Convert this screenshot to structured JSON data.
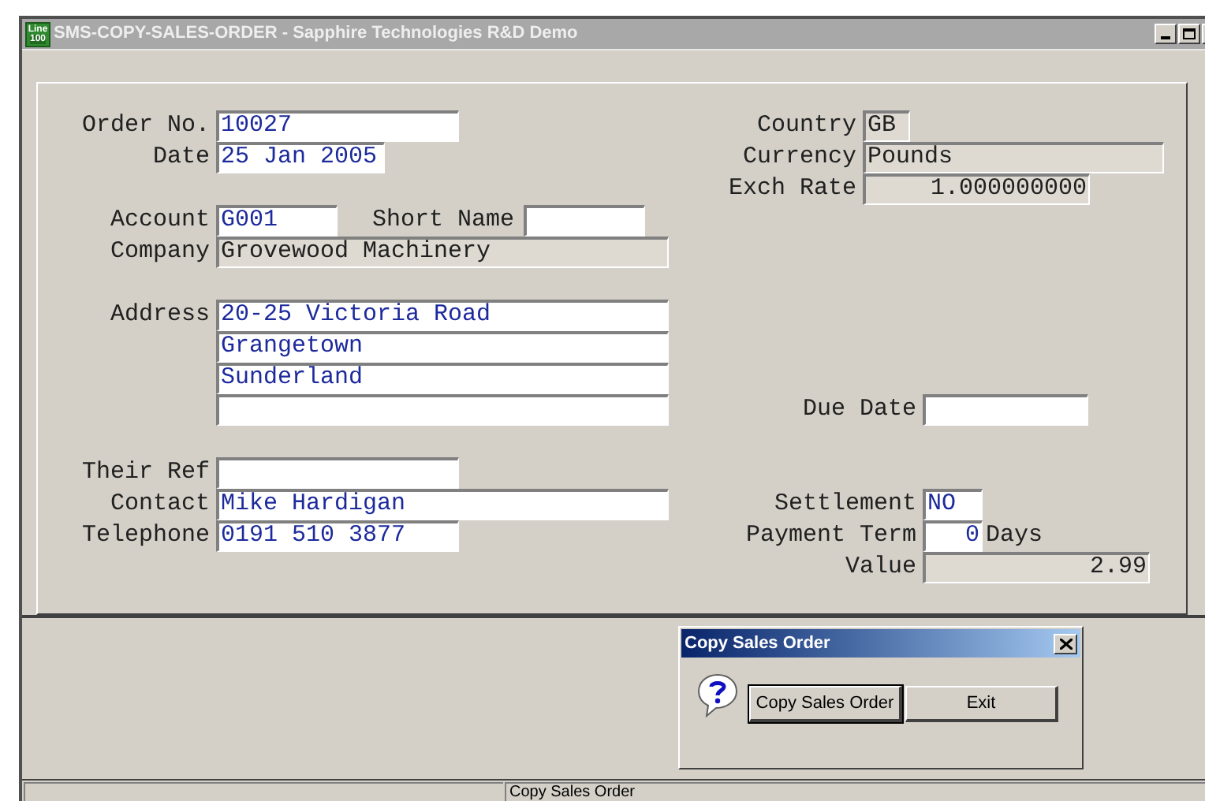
{
  "window": {
    "title": "SMS-COPY-SALES-ORDER - Sapphire Technologies R&D Demo",
    "logo": [
      "Line",
      "100"
    ]
  },
  "form": {
    "order_no": {
      "label": "Order No.",
      "value": "10027",
      "readonly": false
    },
    "date": {
      "label": "Date",
      "value": "25 Jan 2005",
      "readonly": false
    },
    "account": {
      "label": "Account",
      "value": "G001",
      "readonly": false
    },
    "short_name": {
      "label": "Short Name",
      "readonly": false
    },
    "company": {
      "label": "Company",
      "value": "Grovewood Machinery",
      "readonly": true
    },
    "address": {
      "label": "Address",
      "lines": [
        {
          "value": "20-25 Victoria Road",
          "readonly": false
        },
        {
          "value": "Grangetown",
          "readonly": false
        },
        {
          "value": "Sunderland",
          "readonly": false
        },
        {
          "readonly": false
        }
      ]
    },
    "their_ref": {
      "label": "Their Ref",
      "readonly": false
    },
    "contact": {
      "label": "Contact",
      "value": "Mike Hardigan",
      "readonly": false
    },
    "telephone": {
      "label": "Telephone",
      "value": "0191 510 3877",
      "readonly": false
    },
    "country": {
      "label": "Country",
      "value": "GB",
      "readonly": true
    },
    "currency": {
      "label": "Currency",
      "value": "Pounds",
      "readonly": true
    },
    "exch_rate": {
      "label": "Exch Rate",
      "value": "1.000000000",
      "readonly": true
    },
    "due_date": {
      "label": "Due Date",
      "readonly": false
    },
    "settlement": {
      "label": "Settlement",
      "value": "NO",
      "readonly": false
    },
    "payment_term": {
      "label": "Payment Term",
      "value": "0",
      "unit": "Days",
      "readonly": false
    },
    "value": {
      "label": "Value",
      "value": "2.99",
      "readonly": true
    }
  },
  "dialog": {
    "title": "Copy Sales Order",
    "buttons": [
      {
        "label": "Copy Sales Order",
        "default": true
      },
      {
        "label": "Exit",
        "default": false
      }
    ]
  },
  "status_bar": {
    "text": "Copy Sales Order"
  }
}
